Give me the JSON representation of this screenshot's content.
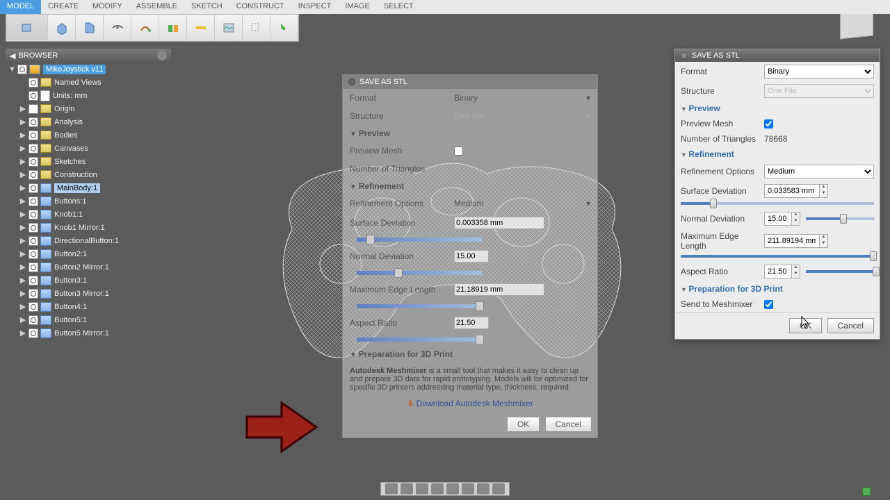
{
  "menubar": {
    "items": [
      {
        "label": "MODEL",
        "active": true
      },
      {
        "label": "CREATE"
      },
      {
        "label": "MODIFY"
      },
      {
        "label": "ASSEMBLE"
      },
      {
        "label": "SKETCH"
      },
      {
        "label": "CONSTRUCT"
      },
      {
        "label": "INSPECT"
      },
      {
        "label": "IMAGE"
      },
      {
        "label": "SELECT"
      }
    ]
  },
  "browser": {
    "title": "BROWSER",
    "root": "MikeJoystick v11",
    "tree": [
      {
        "label": "Named Views",
        "lvl": 1,
        "icon": "folder",
        "eye": true
      },
      {
        "label": "Units: mm",
        "lvl": 1,
        "icon": "doc",
        "eye": true
      },
      {
        "label": "Origin",
        "lvl": 1,
        "icon": "folder",
        "eye": false,
        "tri": "▶"
      },
      {
        "label": "Analysis",
        "lvl": 1,
        "icon": "folder",
        "eye": true,
        "tri": "▶"
      },
      {
        "label": "Bodies",
        "lvl": 1,
        "icon": "folder",
        "eye": true,
        "tri": "▶"
      },
      {
        "label": "Canvases",
        "lvl": 1,
        "icon": "folder",
        "eye": true,
        "tri": "▶"
      },
      {
        "label": "Sketches",
        "lvl": 1,
        "icon": "folder",
        "eye": true,
        "tri": "▶"
      },
      {
        "label": "Construction",
        "lvl": 1,
        "icon": "folder",
        "eye": true,
        "tri": "▶"
      },
      {
        "label": "MainBody:1",
        "lvl": 1,
        "icon": "comp",
        "eye": true,
        "tri": "▶",
        "hover": true
      },
      {
        "label": "Buttons:1",
        "lvl": 1,
        "icon": "comp",
        "eye": true,
        "tri": "▶"
      },
      {
        "label": "Knob1:1",
        "lvl": 1,
        "icon": "comp",
        "eye": true,
        "tri": "▶"
      },
      {
        "label": "Knob1 Mirror:1",
        "lvl": 1,
        "icon": "comp",
        "eye": true,
        "tri": "▶"
      },
      {
        "label": "DirectionalButton:1",
        "lvl": 1,
        "icon": "comp",
        "eye": true,
        "tri": "▶"
      },
      {
        "label": "Button2:1",
        "lvl": 1,
        "icon": "comp",
        "eye": true,
        "tri": "▶"
      },
      {
        "label": "Button2 Mirror:1",
        "lvl": 1,
        "icon": "comp",
        "eye": true,
        "tri": "▶"
      },
      {
        "label": "Button3:1",
        "lvl": 1,
        "icon": "comp",
        "eye": true,
        "tri": "▶"
      },
      {
        "label": "Button3 Mirror:1",
        "lvl": 1,
        "icon": "comp",
        "eye": true,
        "tri": "▶"
      },
      {
        "label": "Button4:1",
        "lvl": 1,
        "icon": "comp",
        "eye": true,
        "tri": "▶"
      },
      {
        "label": "Button5:1",
        "lvl": 1,
        "icon": "comp",
        "eye": true,
        "tri": "▶"
      },
      {
        "label": "Button5 Mirror:1",
        "lvl": 1,
        "icon": "comp",
        "eye": true,
        "tri": "▶"
      }
    ]
  },
  "ghost": {
    "title": "SAVE AS STL",
    "format_label": "Format",
    "format_value": "Binary",
    "structure_label": "Structure",
    "structure_value": "One File",
    "preview_section": "Preview",
    "preview_mesh_label": "Preview Mesh",
    "num_triangles_label": "Number of Triangles",
    "refinement_section": "Refinement",
    "refinement_options_label": "Refinement Options",
    "refinement_options_value": "Medium",
    "surface_dev_label": "Surface Deviation",
    "surface_dev_value": "0.003358 mm",
    "normal_dev_label": "Normal Deviation",
    "normal_dev_value": "15.00",
    "max_edge_label": "Maximum Edge Length",
    "max_edge_value": "21.18919 mm",
    "aspect_label": "Aspect Ratio",
    "aspect_value": "21.50",
    "prep_section": "Preparation for 3D Print",
    "desc_bold": "Autodesk Meshmixer",
    "desc_rest": " is a small tool that makes it easy to clean up and prepare 3D data for rapid prototyping. Models will be optimized for specific 3D printers addressing material type, thickness, required",
    "download_link": "Download Autodesk Meshmixer",
    "ok": "OK",
    "cancel": "Cancel"
  },
  "panel": {
    "title": "SAVE AS STL",
    "format_label": "Format",
    "format_value": "Binary",
    "structure_label": "Structure",
    "structure_value": "One File",
    "preview_section": "Preview",
    "preview_mesh_label": "Preview Mesh",
    "preview_mesh_checked": true,
    "num_triangles_label": "Number of Triangles",
    "num_triangles_value": "78668",
    "refinement_section": "Refinement",
    "refinement_options_label": "Refinement Options",
    "refinement_options_value": "Medium",
    "surface_dev_label": "Surface Deviation",
    "surface_dev_value": "0.033583 mm",
    "normal_dev_label": "Normal Deviation",
    "normal_dev_value": "15.00",
    "max_edge_label": "Maximum Edge Length",
    "max_edge_value": "211.89194 mm",
    "aspect_label": "Aspect Ratio",
    "aspect_value": "21.50",
    "prep_section": "Preparation for 3D Print",
    "send_label": "Send to Meshmixer",
    "send_checked": true,
    "ok": "OK",
    "cancel": "Cancel"
  }
}
